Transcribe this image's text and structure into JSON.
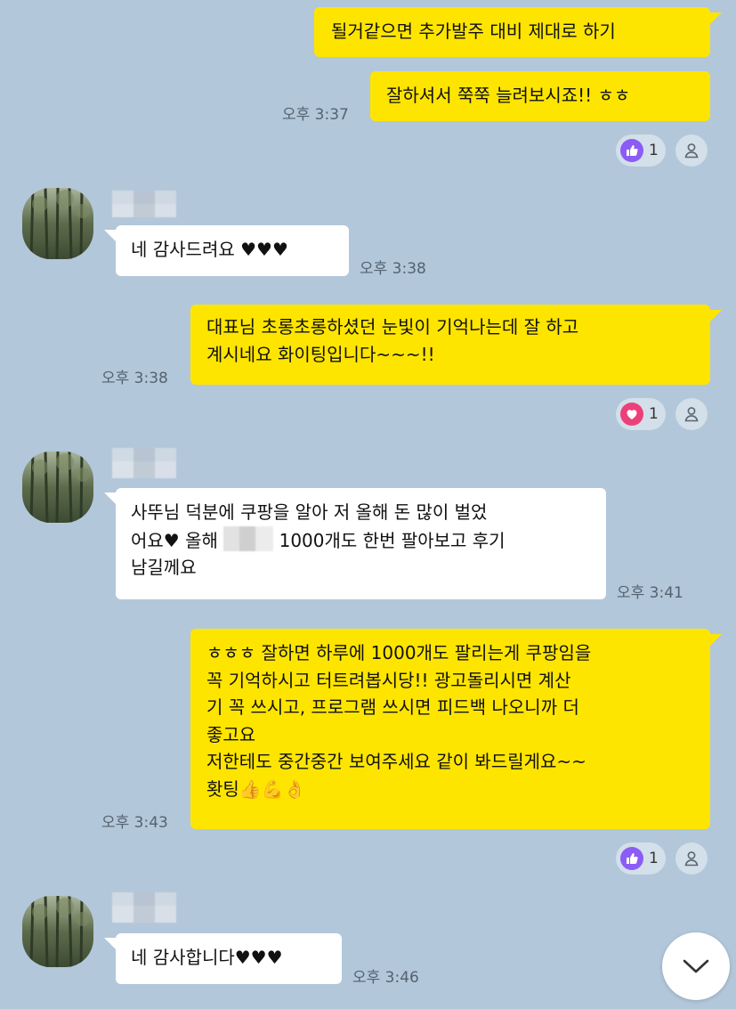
{
  "messages": [
    {
      "id": "m1",
      "side": "me",
      "lines": [
        "될거같으면 추가발주 대비 제대로 하기"
      ]
    },
    {
      "id": "m2",
      "side": "me",
      "lines": [
        "잘하셔서 쭉쭉 늘려보시죠!! ㅎㅎ"
      ],
      "time": "오후 3:37",
      "reaction": {
        "type": "thumbs-up",
        "count": "1"
      }
    },
    {
      "id": "m3",
      "side": "other",
      "lines": [
        "네 감사드려요 ♥♥♥"
      ],
      "time": "오후 3:38"
    },
    {
      "id": "m4",
      "side": "me",
      "lines": [
        "대표님 초롱초롱하셨던 눈빛이 기억나는데 잘 하고",
        "계시네요 화이팅입니다~~~!!"
      ],
      "time": "오후 3:38",
      "reaction": {
        "type": "heart",
        "count": "1"
      }
    },
    {
      "id": "m5",
      "side": "other",
      "lines": [
        "사뚜님 덕분에 쿠팡을 알아 저 올해 돈 많이 벌었",
        "어요♥ 올해",
        "1000개도 한번 팔아보고 후기",
        "남길께요"
      ],
      "time": "오후 3:41"
    },
    {
      "id": "m6",
      "side": "me",
      "lines": [
        "ㅎㅎㅎ 잘하면 하루에 1000개도 팔리는게 쿠팡임을",
        " 꼭 기억하시고 터트려봅시당!! 광고돌리시면 계산",
        "기 꼭 쓰시고, 프로그램 쓰시면 피드백 나오니까 더",
        "좋고요",
        "저한테도 중간중간 보여주세요 같이 봐드릴게요~~",
        "홧팅👍💪👌"
      ],
      "time": "오후 3:43",
      "reaction": {
        "type": "thumbs-up",
        "count": "1"
      }
    },
    {
      "id": "m7",
      "side": "other",
      "lines": [
        "네 감사합니다♥♥♥"
      ],
      "time": "오후 3:46"
    }
  ],
  "icons": {
    "thumbs_up": "thumbs-up-icon",
    "heart": "heart-icon",
    "person": "person-icon",
    "scroll_down": "chevron-down-icon"
  },
  "colors": {
    "background": "#b2c7da",
    "my_bubble": "#fee500",
    "other_bubble": "#ffffff",
    "thumbs_up": "#8b5cf6",
    "heart": "#ec407a"
  }
}
